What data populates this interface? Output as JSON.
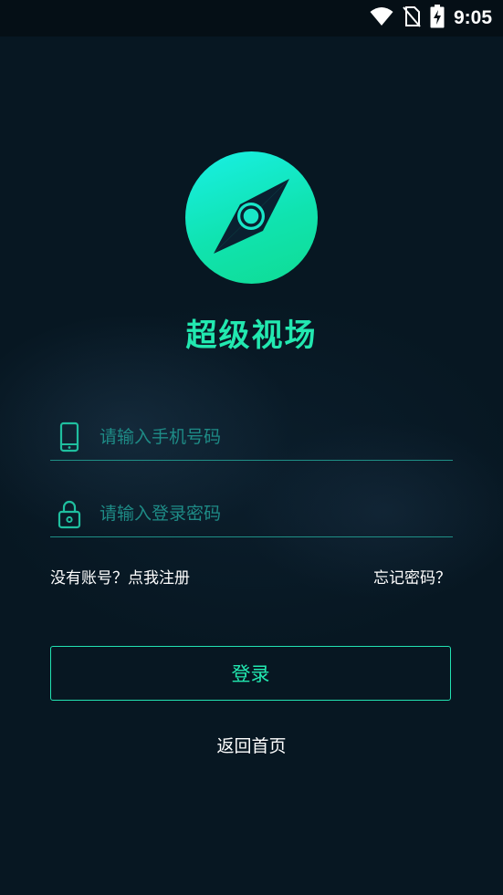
{
  "status_bar": {
    "time": "9:05",
    "icons": [
      "wifi-icon",
      "no-sim-icon",
      "battery-charging-icon"
    ]
  },
  "app": {
    "title": "超级视场",
    "logo_icon": "compass-icon"
  },
  "form": {
    "phone_placeholder": "请输入手机号码",
    "phone_value": "",
    "password_placeholder": "请输入登录密码",
    "password_value": ""
  },
  "links": {
    "register": "没有账号？点我注册",
    "forgot_password": "忘记密码？",
    "home": "返回首页"
  },
  "buttons": {
    "login": "登录"
  },
  "colors": {
    "background": "#071722",
    "accent": "#22e8b0",
    "underline": "#1f8f86",
    "placeholder": "#1e8b86"
  }
}
